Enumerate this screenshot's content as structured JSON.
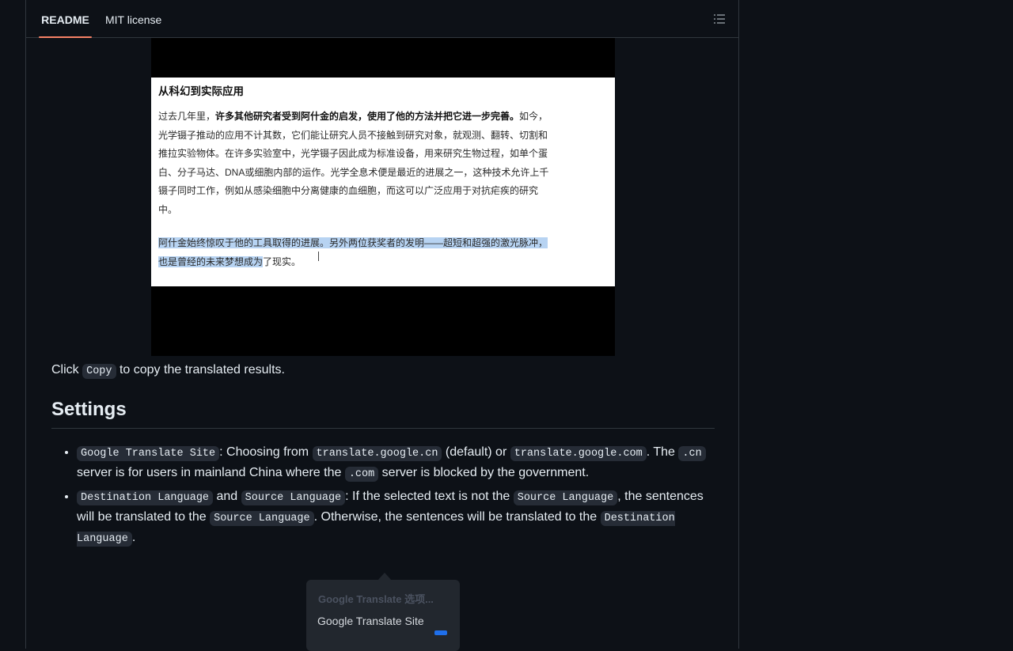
{
  "tabs": [
    {
      "label": "README",
      "active": true
    },
    {
      "label": "MIT license",
      "active": false
    }
  ],
  "toc_icon": "list-unordered-icon",
  "screenshot": {
    "heading": "从科幻到实际应用",
    "p1_intro": "过去几年里，",
    "p1_bold": "许多其他研究者受到阿什金的启发，使用了他的方法并把它进一步完善。",
    "p1_rest": "如今，光学镊子推动的应用不计其数，它们能让研究人员不接触到研究对象，就观测、翻转、切割和推拉实验物体。在许多实验室中，光学镊子因此成为标准设备，用来研究生物过程，如单个蛋白、分子马达、DNA或细胞内部的运作。光学全息术便是最近的进展之一，这种技术允许上千镊子同时工作，例如从感染细胞中分离健康的血细胞，而这可以广泛应用于对抗疟疾的研究中。",
    "p2_highlight": "阿什金始终惊叹于他的工具取得的进展。另外两位获奖者的发明——超短和超强的激光脉冲，也是曾经的未来梦想成为",
    "p2_rest": "了现实。"
  },
  "caption": {
    "before": "Click ",
    "code": "Copy",
    "after": " to copy the translated results."
  },
  "settings": {
    "heading": "Settings",
    "item1": {
      "code_site": "Google Translate Site",
      "t1": ": Choosing from ",
      "code_cn": "translate.google.cn",
      "t2": " (default) or ",
      "code_com": "translate.google.com",
      "t3": ". The ",
      "code_cn_short": ".cn",
      "t4": " server is for users in mainland China where the ",
      "code_com_short": ".com",
      "t5": " server is blocked by the government."
    },
    "item2": {
      "code_dest": "Destination Language",
      "t1": " and ",
      "code_src": "Source Language",
      "t2": ": If the selected text is not the ",
      "code_src2": "Source Language",
      "t3": ", the sentences will be translated to the ",
      "code_src3": "Source Language",
      "t4": ". Otherwise, the sentences will be translated to the ",
      "code_dest2": "Destination Language",
      "t5": "."
    }
  },
  "popup": {
    "title": "Google Translate 选项...",
    "item": "Google Translate Site"
  }
}
